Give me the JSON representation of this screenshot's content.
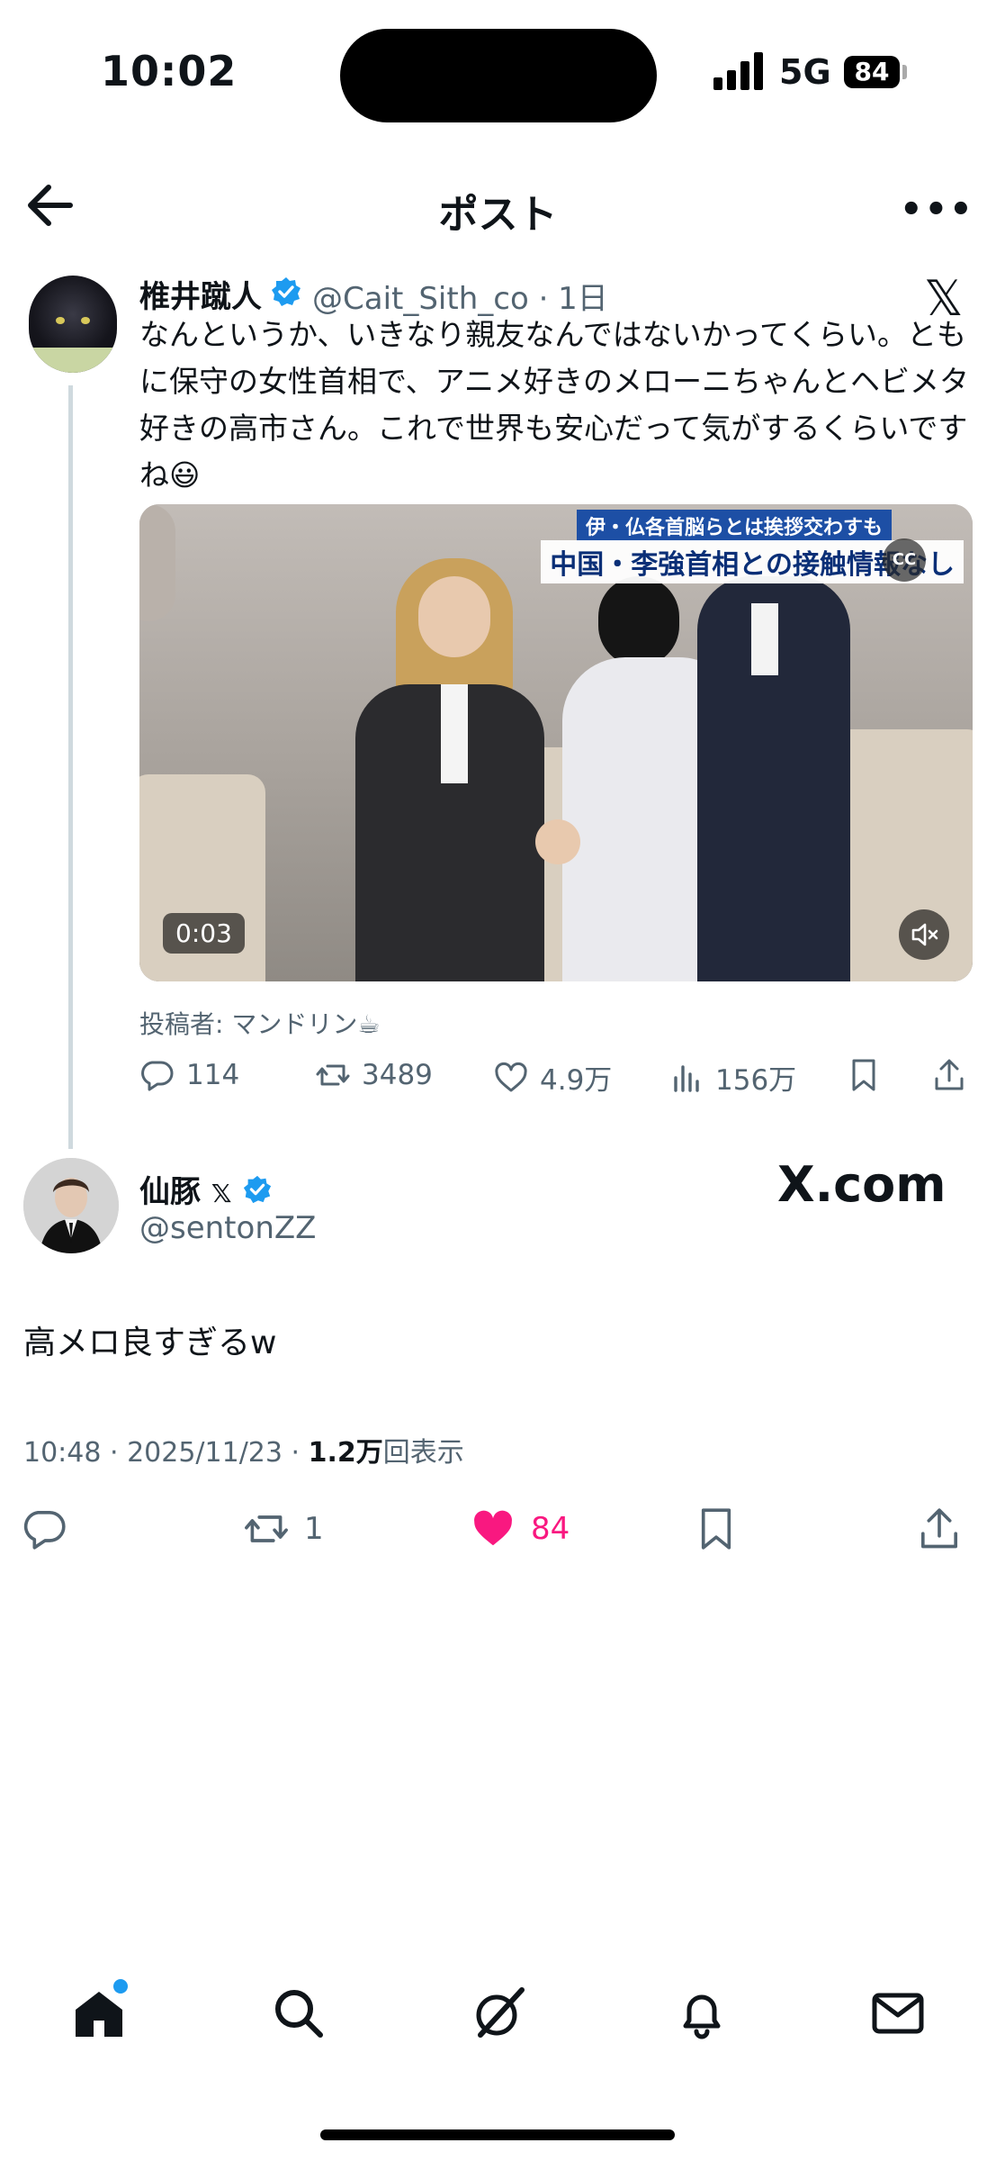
{
  "status_bar": {
    "time": "10:02",
    "network": "5G",
    "battery": "84"
  },
  "header": {
    "title": "ポスト",
    "more": "•••"
  },
  "quoted_post": {
    "name": "椎井蹴人",
    "handle_time": "@Cait_Sith_co · 1日",
    "x_logo": "𝕏",
    "text": "なんというか、いきなり親友なんではないかってくらい。ともに保守の女性首相で、アニメ好きのメローニちゃんとヘビメタ好きの高市さん。これで世界も安心だって気がするくらいですね😃",
    "video": {
      "caption_top": "伊・仏各首脳らとは挨拶交わすも",
      "caption_main": "中国・李強首相との接触情報なし",
      "cc": "CC",
      "duration": "0:03"
    },
    "poster": "投稿者: マンドリン☕",
    "actions": {
      "replies": "114",
      "reposts": "3489",
      "likes": "4.9万",
      "views": "156万"
    }
  },
  "main_post": {
    "name": "仙豚",
    "name_badge": "𝕏",
    "handle": "@sentonZZ",
    "watermark": "X.com",
    "text": "高メロ良すぎるw",
    "meta_time": "10:48 · 2025/11/23 · ",
    "meta_views": "1.2万",
    "meta_suffix": "回表示",
    "actions": {
      "reposts": "1",
      "likes": "84"
    }
  },
  "colors": {
    "accent": "#1d9bf0",
    "like": "#f91880",
    "secondary_text": "#536471"
  },
  "nav": [
    "home-icon",
    "search-icon",
    "grok-icon",
    "notifications-icon",
    "messages-icon"
  ]
}
